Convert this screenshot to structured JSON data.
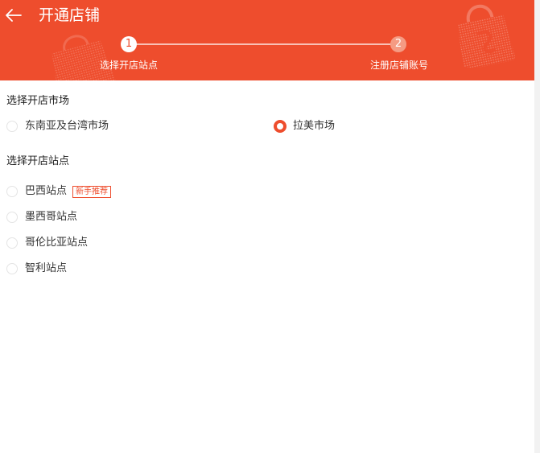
{
  "header": {
    "title": "开通店铺",
    "back_icon": "arrow-left-icon",
    "bg_color": "#ee4d2d"
  },
  "stepper": {
    "steps": [
      {
        "number": "1",
        "label": "选择开店站点",
        "active": true
      },
      {
        "number": "2",
        "label": "注册店铺账号",
        "active": false
      }
    ]
  },
  "market": {
    "title": "选择开店市场",
    "options": [
      {
        "label": "东南亚及台湾市场",
        "selected": false
      },
      {
        "label": "拉美市场",
        "selected": true
      }
    ]
  },
  "site": {
    "title": "选择开店站点",
    "options": [
      {
        "label": "巴西站点",
        "tag": "新手推荐",
        "selected": false
      },
      {
        "label": "墨西哥站点",
        "selected": false
      },
      {
        "label": "哥伦比亚站点",
        "selected": false
      },
      {
        "label": "智利站点",
        "selected": false
      }
    ]
  },
  "colors": {
    "accent": "#ee4d2d",
    "text": "#333333",
    "radio_border": "#e4e4e4"
  }
}
